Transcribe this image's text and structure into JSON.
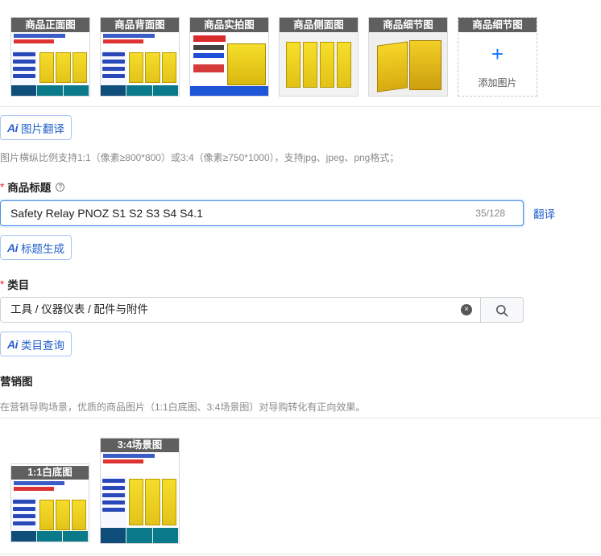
{
  "main_images": [
    {
      "caption": "商品正面图",
      "kind": "front"
    },
    {
      "caption": "商品背面图",
      "kind": "back"
    },
    {
      "caption": "商品实拍图",
      "kind": "real"
    },
    {
      "caption": "商品侧面图",
      "kind": "side"
    },
    {
      "caption": "商品细节图",
      "kind": "detail"
    }
  ],
  "add_image": {
    "caption": "商品细节图",
    "plus": "+",
    "label": "添加图片"
  },
  "image_translate_button": {
    "icon": "Ai",
    "label": "图片翻译"
  },
  "image_hint": "图片横纵比例支持1:1（像素≥800*800）或3:4（像素≥750*1000），支持jpg、jpeg、png格式；",
  "title_field": {
    "required_mark": "*",
    "label": "商品标题",
    "help_icon": "?",
    "value": "Safety Relay PNOZ S1 S2  S3 S4 S4.1",
    "counter": "35/128",
    "translate_link": "翻译"
  },
  "title_generate_button": {
    "icon": "Ai",
    "label": "标题生成"
  },
  "category_field": {
    "required_mark": "*",
    "label": "类目",
    "value": "工具 / 仪器仪表 / 配件与附件",
    "clear_icon": "×"
  },
  "category_query_button": {
    "icon": "Ai",
    "label": "类目查询"
  },
  "marketing": {
    "label": "营销图",
    "hint": "在营销导购场景，优质的商品图片（1:1白底图、3:4场景图）对导购转化有正向效果。",
    "images": [
      {
        "caption": "1:1白底图"
      },
      {
        "caption": "3:4场景图"
      }
    ]
  },
  "colors": {
    "accent": "#2060c9",
    "focus_border": "#4a90e2",
    "required": "#ee2233"
  }
}
